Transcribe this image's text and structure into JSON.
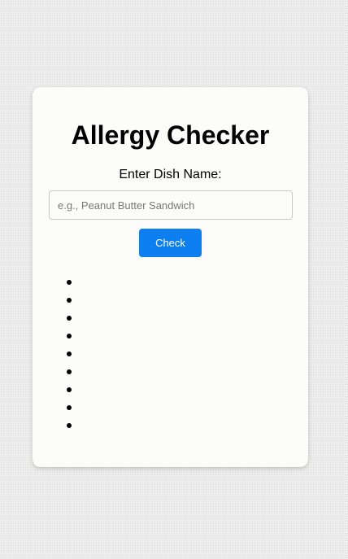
{
  "app": {
    "title": "Allergy Checker"
  },
  "form": {
    "label": "Enter Dish Name:",
    "input_value": "",
    "placeholder": "e.g., Peanut Butter Sandwich",
    "button_label": "Check"
  },
  "results": {
    "items": [
      "",
      "",
      "",
      "",
      "",
      "",
      "",
      "",
      ""
    ]
  },
  "colors": {
    "accent": "#0d7ff0",
    "card_background": "#fcfcfb"
  }
}
